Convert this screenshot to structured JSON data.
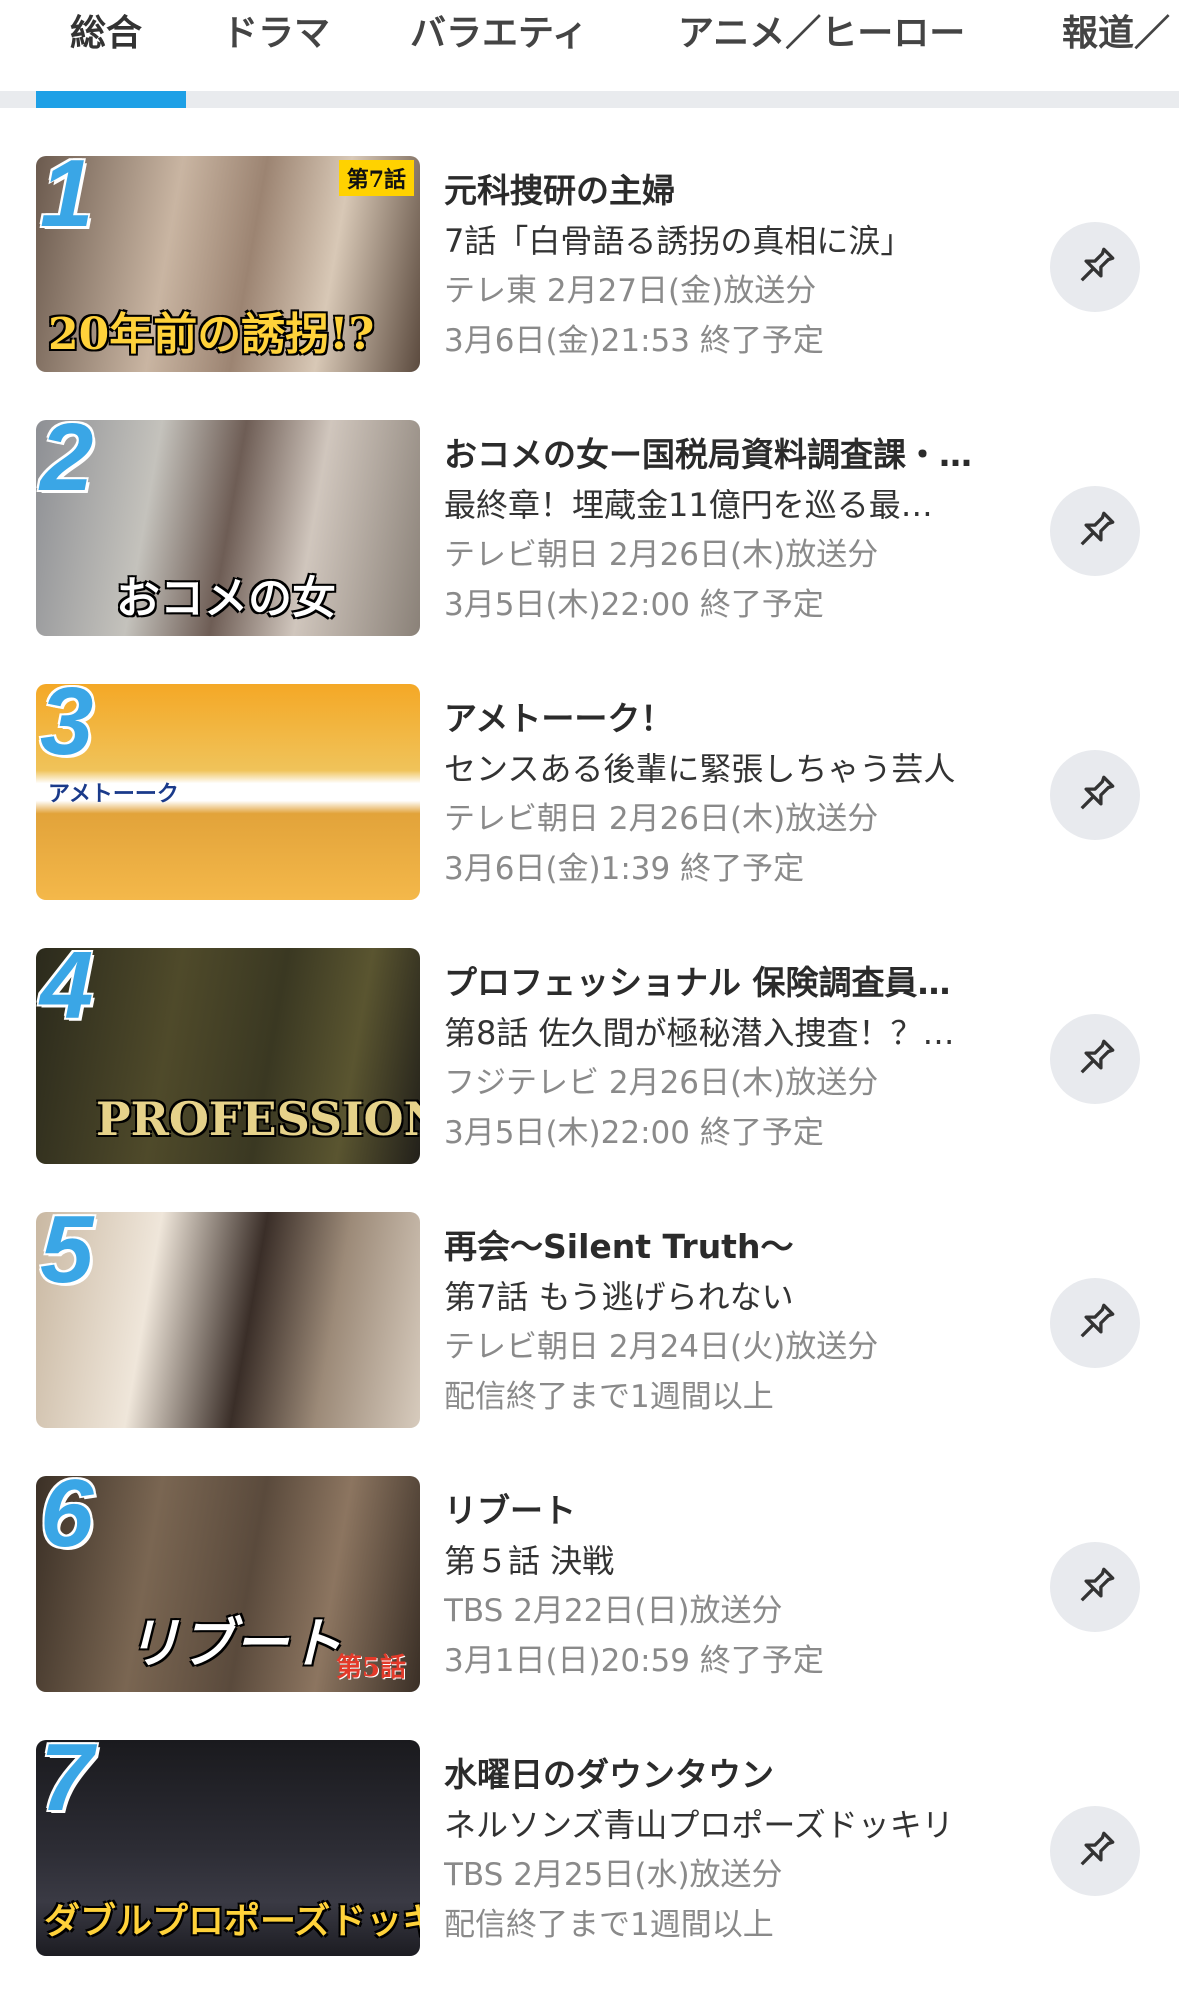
{
  "tabs": [
    {
      "label": "総合",
      "active": true
    },
    {
      "label": "ドラマ",
      "active": false
    },
    {
      "label": "バラエティ",
      "active": false
    },
    {
      "label": "アニメ／ヒーロー",
      "active": false
    },
    {
      "label": "報道／",
      "active": false
    }
  ],
  "accent_color": "#1ea0e6",
  "items": [
    {
      "rank": "1",
      "title": "元科捜研の主婦",
      "subtitle": "7話「白骨語る誘拐の真相に涙」",
      "broadcast": "テレ東 2月27日(金)放送分",
      "expiry": "3月6日(金)21:53 終了予定",
      "thumb_text": "20年前の誘拐!?",
      "thumb_badge": "第7話"
    },
    {
      "rank": "2",
      "title": "おコメの女ー国税局資料調査課・…",
      "subtitle": "最終章！埋蔵金11億円を巡る最…",
      "broadcast": "テレビ朝日 2月26日(木)放送分",
      "expiry": "3月5日(木)22:00 終了予定",
      "thumb_text": "おコメの女",
      "thumb_badge": ""
    },
    {
      "rank": "3",
      "title": "アメトーーク！",
      "subtitle": "センスある後輩に緊張しちゃう芸人",
      "broadcast": "テレビ朝日 2月26日(木)放送分",
      "expiry": "3月6日(金)1:39 終了予定",
      "thumb_text": "アメトーーク",
      "thumb_badge": ""
    },
    {
      "rank": "4",
      "title": "プロフェッショナル 保険調査員…",
      "subtitle": "第8話 佐久間が極秘潜入捜査！？…",
      "broadcast": "フジテレビ 2月26日(木)放送分",
      "expiry": "3月5日(木)22:00 終了予定",
      "thumb_text": "PROFESSIONAL",
      "thumb_badge": ""
    },
    {
      "rank": "5",
      "title": "再会～Silent Truth～",
      "subtitle": "第7話 もう逃げられない",
      "broadcast": "テレビ朝日 2月24日(火)放送分",
      "expiry": "配信終了まで1週間以上",
      "thumb_text": "",
      "thumb_badge": ""
    },
    {
      "rank": "6",
      "title": "リブート",
      "subtitle": "第５話 決戦",
      "broadcast": "TBS 2月22日(日)放送分",
      "expiry": "3月1日(日)20:59 終了予定",
      "thumb_text": "リブート",
      "thumb_badge": "第5話"
    },
    {
      "rank": "7",
      "title": "水曜日のダウンタウン",
      "subtitle": "ネルソンズ青山プロポーズドッキリ",
      "broadcast": "TBS 2月25日(水)放送分",
      "expiry": "配信終了まで1週間以上",
      "thumb_text": "ダブルプロポーズドッキリ",
      "thumb_badge": ""
    }
  ]
}
